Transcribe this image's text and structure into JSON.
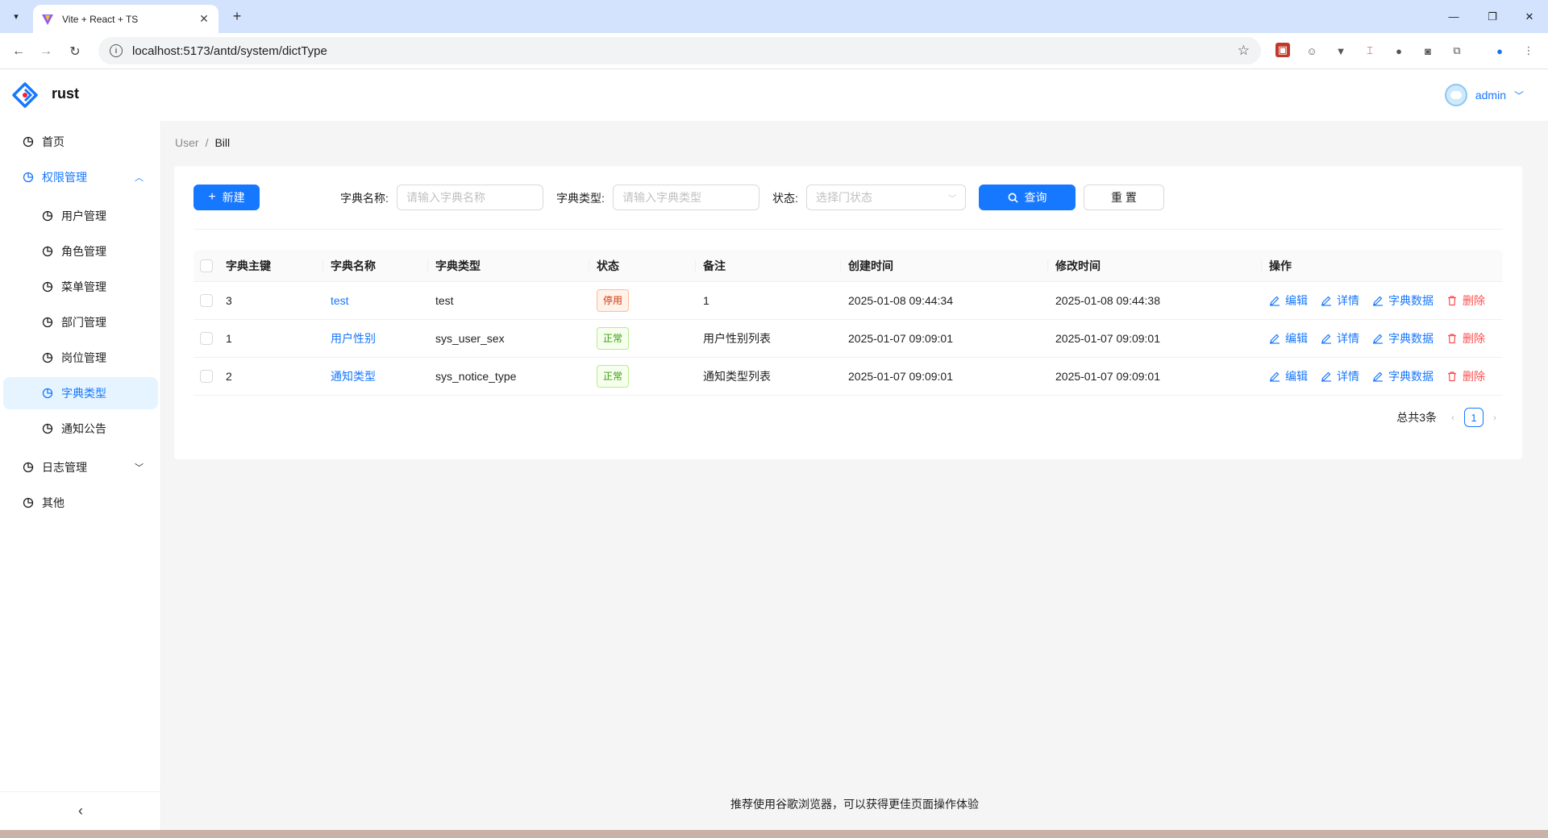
{
  "browser": {
    "tab_title": "Vite + React + TS",
    "url": "localhost:5173/antd/system/dictType"
  },
  "header": {
    "brand": "rust",
    "username": "admin"
  },
  "sidebar": {
    "items": [
      {
        "label": "首页"
      },
      {
        "label": "权限管理"
      },
      {
        "label": "用户管理"
      },
      {
        "label": "角色管理"
      },
      {
        "label": "菜单管理"
      },
      {
        "label": "部门管理"
      },
      {
        "label": "岗位管理"
      },
      {
        "label": "字典类型"
      },
      {
        "label": "通知公告"
      },
      {
        "label": "日志管理"
      },
      {
        "label": "其他"
      }
    ],
    "collapse_icon": "chevron-left-icon"
  },
  "breadcrumb": {
    "items": [
      "User",
      "Bill"
    ],
    "separator": "/"
  },
  "toolbar": {
    "new_label": "新建",
    "query_label": "查询",
    "reset_label": "重 置"
  },
  "filters": {
    "name_label": "字典名称:",
    "name_placeholder": "请输入字典名称",
    "type_label": "字典类型:",
    "type_placeholder": "请输入字典类型",
    "status_label": "状态:",
    "status_placeholder": "选择门状态"
  },
  "table": {
    "columns": [
      "字典主键",
      "字典名称",
      "字典类型",
      "状态",
      "备注",
      "创建时间",
      "修改时间",
      "操作"
    ],
    "rows": [
      {
        "id": "3",
        "name": "test",
        "type": "test",
        "status": "停用",
        "remark": "1",
        "created": "2025-01-08 09:44:34",
        "updated": "2025-01-08 09:44:38"
      },
      {
        "id": "1",
        "name": "用户性别",
        "type": "sys_user_sex",
        "status": "正常",
        "remark": "用户性别列表",
        "created": "2025-01-07 09:09:01",
        "updated": "2025-01-07 09:09:01"
      },
      {
        "id": "2",
        "name": "通知类型",
        "type": "sys_notice_type",
        "status": "正常",
        "remark": "通知类型列表",
        "created": "2025-01-07 09:09:01",
        "updated": "2025-01-07 09:09:01"
      }
    ],
    "actions": {
      "edit": "编辑",
      "detail": "详情",
      "dict_data": "字典数据",
      "delete": "删除"
    }
  },
  "pagination": {
    "total_text": "总共3条",
    "current_page": "1"
  },
  "footer": {
    "text": "推荐使用谷歌浏览器，可以获得更佳页面操作体验"
  },
  "colors": {
    "primary": "#1677ff",
    "danger": "#ff4d4f",
    "tag_disabled": "#d4380d",
    "tag_normal": "#389e0d"
  }
}
